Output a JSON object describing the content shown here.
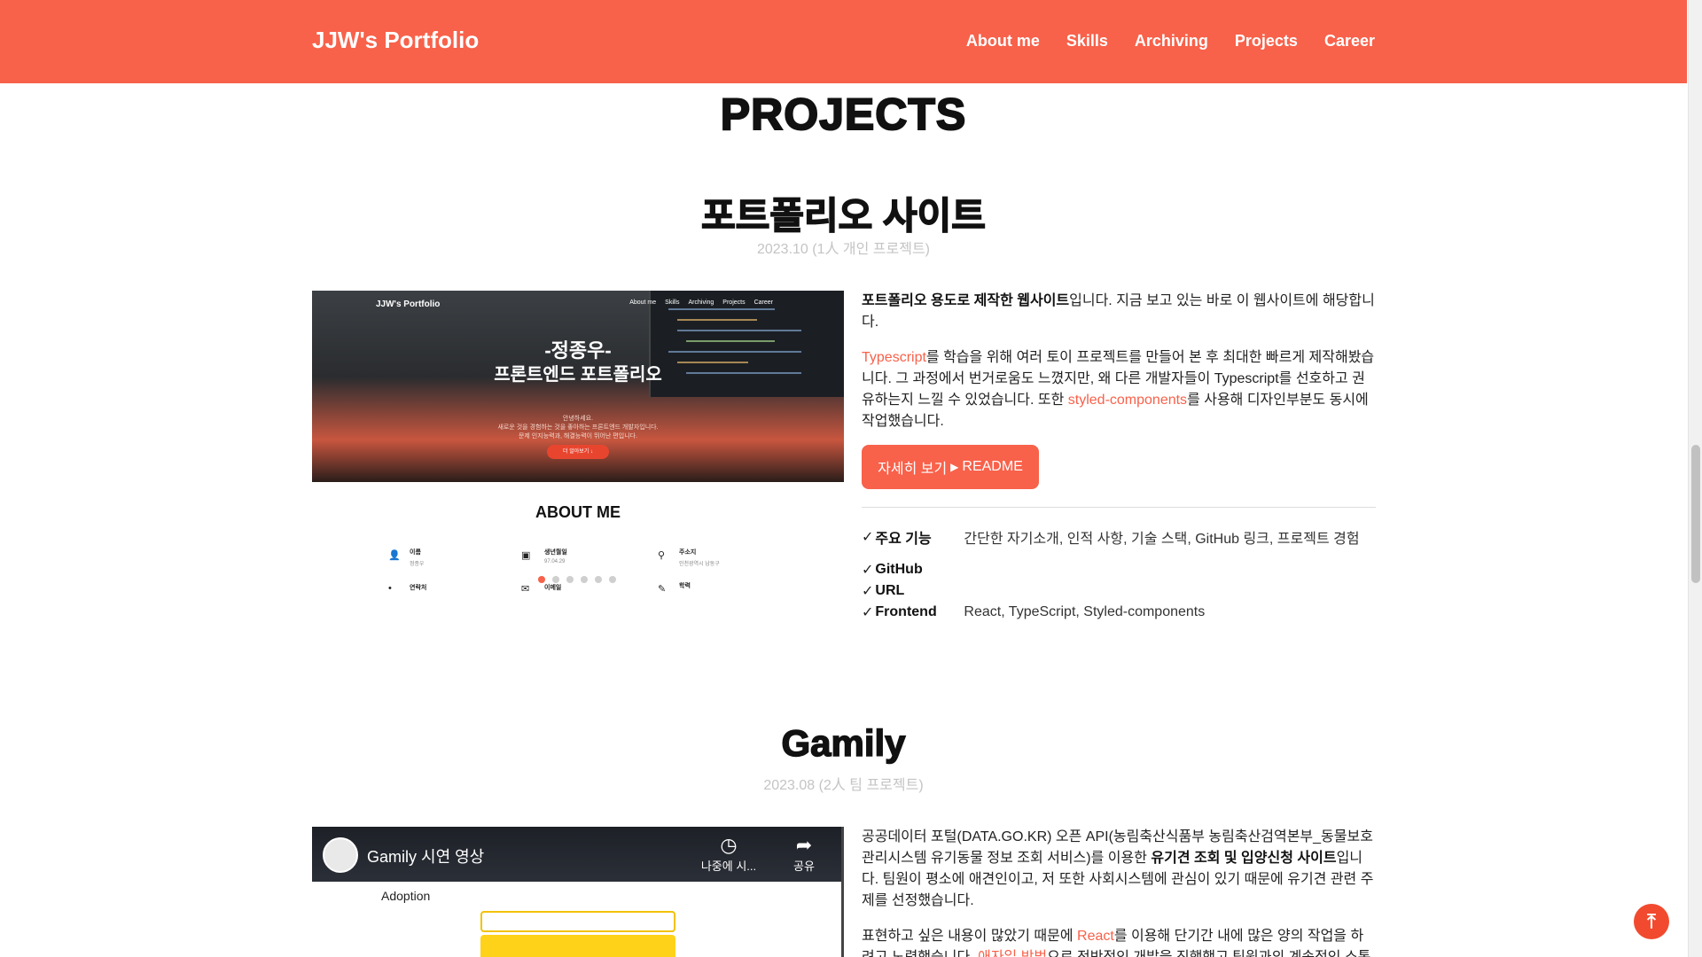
{
  "nav": {
    "brand": "JJW's Portfolio",
    "links": [
      "About me",
      "Skills",
      "Archiving",
      "Projects",
      "Career"
    ]
  },
  "section": {
    "title": "PROJECTS"
  },
  "projects": [
    {
      "title": "포트폴리오 사이트",
      "date": "2023.10 (1人 개인 프로젝트)",
      "preview": {
        "brand": "JJW's Portfolio",
        "nav": [
          "About me",
          "Skills",
          "Archiving",
          "Projects",
          "Career"
        ],
        "title_line1": "-정종우-",
        "title_line2": "프론트엔드 포트폴리오",
        "sub_line1": "안녕하세요.",
        "sub_line2": "새로운 것을 경험하는 것을 좋아하는 프론트엔드 개발자입니다.",
        "sub_line3": "문제 인지능력과, 해결능력이 뛰어난 편입니다.",
        "button": "더 알아보기 ↓",
        "about_title": "ABOUT ME",
        "about_items": [
          {
            "label": "이름",
            "value": "정종우"
          },
          {
            "label": "생년월일",
            "value": "97.04.29"
          },
          {
            "label": "주소지",
            "value": "인천광역시 남동구"
          },
          {
            "label": "연락처",
            "value": ""
          },
          {
            "label": "이메일",
            "value": ""
          },
          {
            "label": "학력",
            "value": ""
          }
        ],
        "dots_total": 6,
        "dots_active": 1
      },
      "desc_p1_bold": "포트폴리오 용도로 제작한 웹사이트",
      "desc_p1_rest": "입니다. 지금 보고 있는 바로 이 웹사이트에 해당합니다.",
      "desc_p2_link1": "Typescript",
      "desc_p2_a": "를 학습을 위해 여러 토이 프로젝트를 만들어 본 후 최대한 빠르게 제작해봤습니다. 그 과정에서 번거로움도 느꼈지만, 왜 다른 개발자들이 Typescript를 선호하고 권유하는지 느낄 수 있었습니다. 또한 ",
      "desc_p2_link2": "styled-components",
      "desc_p2_b": "를 사용해 디자인부분도 동시에 작업했습니다.",
      "readme_label": "자세히 보기",
      "readme_link": "README",
      "features": [
        {
          "label": "주요 기능",
          "value": "간단한 자기소개, 인적 사항, 기술 스택, GitHub 링크, 프로젝트 경험"
        },
        {
          "label": "GitHub",
          "value": ""
        },
        {
          "label": "URL",
          "value": ""
        },
        {
          "label": "Frontend",
          "value": "React, TypeScript, Styled-components"
        }
      ]
    },
    {
      "title": "Gamily",
      "date": "2023.08 (2人 팀 프로젝트)",
      "video": {
        "title": "Gamily 시연 영상",
        "action_later": "나중에 시...",
        "action_share": "공유",
        "adoption": "Adoption"
      },
      "desc_p1_a": "공공데이터 포털(DATA.GO.KR) 오픈 API(농림축산식품부 농림축산검역본부_동물보호관리시스템 유기동물 정보 조회 서비스)를 이용한 ",
      "desc_p1_bold": "유기견 조회 및 입양신청 사이트",
      "desc_p1_b": "입니다. 팀원이 평소에 애견인이고, 저 또한 사회시스템에 관심이 있기 때문에 유기견 관련 주제를 선정했습니다.",
      "desc_p2_a": "표현하고 싶은 내용이 많았기 때문에 ",
      "desc_p2_link1": "React",
      "desc_p2_b": "를 이용해 단기간 내에 많은 양의 작업을 하려고 노력했습니다. ",
      "desc_p2_link2": "애자일 방법",
      "desc_p2_c": "으로 전반적인 개발을 진행했고 팀원과의 계속적인 소통과"
    }
  ],
  "colors": {
    "accent": "#f8614a",
    "date": "#c4c4c4"
  },
  "icons": {
    "scroll_top": "arrow-up-to-top-icon"
  }
}
